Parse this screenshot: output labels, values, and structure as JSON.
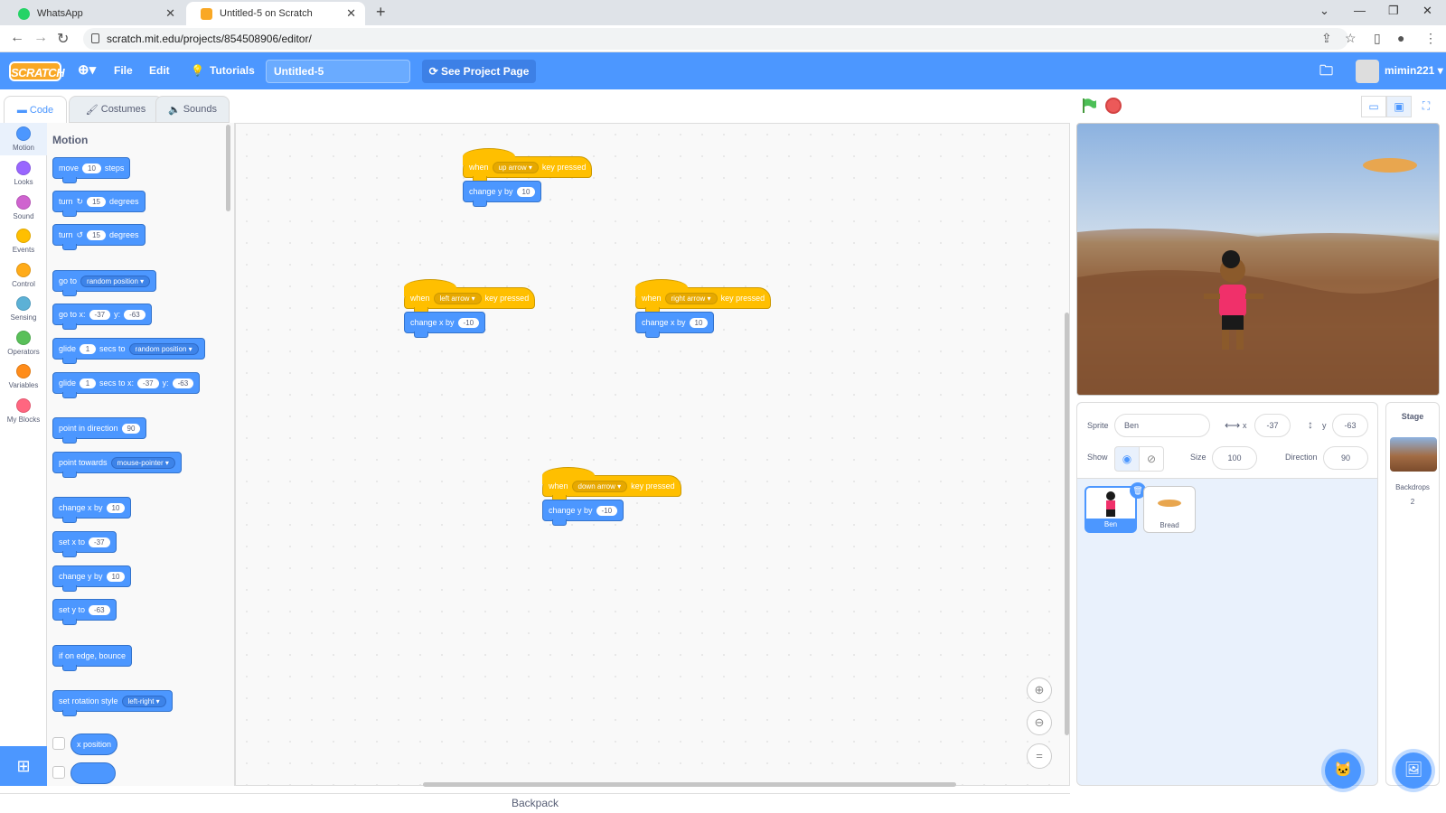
{
  "browser": {
    "tabs": [
      {
        "title": "WhatsApp"
      },
      {
        "title": "Untitled-5 on Scratch"
      }
    ],
    "url": "scratch.mit.edu/projects/854508906/editor/"
  },
  "menu": {
    "logo": "SCRATCH",
    "file": "File",
    "edit": "Edit",
    "tutorials": "Tutorials",
    "project_title": "Untitled-5",
    "see_project_page": "See Project Page",
    "username": "mimin221"
  },
  "editor_tabs": {
    "code": "Code",
    "costumes": "Costumes",
    "sounds": "Sounds"
  },
  "categories": [
    {
      "label": "Motion",
      "color": "#4c97ff"
    },
    {
      "label": "Looks",
      "color": "#9966ff"
    },
    {
      "label": "Sound",
      "color": "#cf63cf"
    },
    {
      "label": "Events",
      "color": "#ffbf00"
    },
    {
      "label": "Control",
      "color": "#ffab19"
    },
    {
      "label": "Sensing",
      "color": "#5cb1d6"
    },
    {
      "label": "Operators",
      "color": "#59c059"
    },
    {
      "label": "Variables",
      "color": "#ff8c1a"
    },
    {
      "label": "My Blocks",
      "color": "#ff6680"
    }
  ],
  "palette": {
    "heading": "Motion",
    "move": {
      "a": "move",
      "n": "10",
      "b": "steps"
    },
    "turn_right": {
      "a": "turn",
      "n": "15",
      "b": "degrees"
    },
    "turn_left": {
      "a": "turn",
      "n": "15",
      "b": "degrees"
    },
    "goto": {
      "a": "go to",
      "dd": "random position"
    },
    "goto_xy": {
      "a": "go to x:",
      "x": "-37",
      "b": "y:",
      "y": "-63"
    },
    "glide_to": {
      "a": "glide",
      "n": "1",
      "b": "secs to",
      "dd": "random position"
    },
    "glide_xy": {
      "a": "glide",
      "n": "1",
      "b": "secs to x:",
      "x": "-37",
      "c": "y:",
      "y": "-63"
    },
    "point_dir": {
      "a": "point in direction",
      "n": "90"
    },
    "point_towards": {
      "a": "point towards",
      "dd": "mouse-pointer"
    },
    "change_x": {
      "a": "change x by",
      "n": "10"
    },
    "set_x": {
      "a": "set x to",
      "n": "-37"
    },
    "change_y": {
      "a": "change y by",
      "n": "10"
    },
    "set_y": {
      "a": "set y to",
      "n": "-63"
    },
    "bounce": {
      "a": "if on edge, bounce"
    },
    "rotation": {
      "a": "set rotation style",
      "dd": "left-right"
    },
    "x_position": "x position"
  },
  "scripts": {
    "up": {
      "when": "when",
      "key": "up arrow",
      "pressed": "key pressed",
      "action": "change y by",
      "value": "10"
    },
    "left": {
      "when": "when",
      "key": "left arrow",
      "pressed": "key pressed",
      "action": "change x by",
      "value": "-10"
    },
    "right": {
      "when": "when",
      "key": "right arrow",
      "pressed": "key pressed",
      "action": "change x by",
      "value": "10"
    },
    "down": {
      "when": "when",
      "key": "down arrow",
      "pressed": "key pressed",
      "action": "change y by",
      "value": "-10"
    }
  },
  "backpack": "Backpack",
  "sprite_info": {
    "sprite_label": "Sprite",
    "sprite_name": "Ben",
    "x_label": "x",
    "x": "-37",
    "y_label": "y",
    "y": "-63",
    "show_label": "Show",
    "size_label": "Size",
    "size": "100",
    "direction_label": "Direction",
    "direction": "90"
  },
  "sprites": [
    {
      "name": "Ben"
    },
    {
      "name": "Bread"
    }
  ],
  "stage_pane": {
    "title": "Stage",
    "backdrops_label": "Backdrops",
    "backdrops_count": "2"
  }
}
